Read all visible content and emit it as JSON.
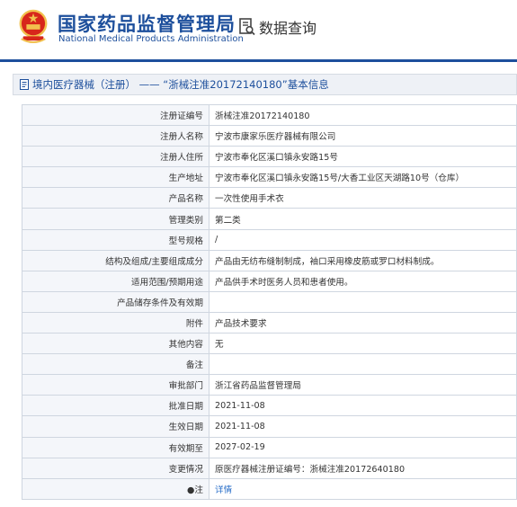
{
  "header": {
    "org_cn": "国家药品监督管理局",
    "org_en": "National Medical Products Administration",
    "query": "数据查询",
    "brand_color": "#1d4f9c",
    "emblem_icon": "national-emblem-icon",
    "query_icon": "document-search-icon"
  },
  "titlebar": {
    "text": "境内医疗器械（注册） —— “浙械注准20172140180”基本信息",
    "icon": "document-icon"
  },
  "rows": [
    {
      "label": "注册证编号",
      "value": "浙械注准20172140180"
    },
    {
      "label": "注册人名称",
      "value": "宁波市康家乐医疗器械有限公司"
    },
    {
      "label": "注册人住所",
      "value": "宁波市奉化区溪口镇永安路15号"
    },
    {
      "label": "生产地址",
      "value": "宁波市奉化区溪口镇永安路15号/大香工业区天湖路10号（仓库）"
    },
    {
      "label": "产品名称",
      "value": "一次性使用手术衣"
    },
    {
      "label": "管理类别",
      "value": "第二类"
    },
    {
      "label": "型号规格",
      "value": "/"
    },
    {
      "label": "结构及组成/主要组成成分",
      "value": "产品由无纺布缝制制成，袖口采用橡皮筋或罗口材料制成。"
    },
    {
      "label": "适用范围/预期用途",
      "value": "产品供手术时医务人员和患者使用。"
    },
    {
      "label": "产品储存条件及有效期",
      "value": ""
    },
    {
      "label": "附件",
      "value": "产品技术要求"
    },
    {
      "label": "其他内容",
      "value": "无"
    },
    {
      "label": "备注",
      "value": ""
    },
    {
      "label": "审批部门",
      "value": "浙江省药品监督管理局"
    },
    {
      "label": "批准日期",
      "value": "2021-11-08"
    },
    {
      "label": "生效日期",
      "value": "2021-11-08"
    },
    {
      "label": "有效期至",
      "value": "2027-02-19"
    },
    {
      "label": "变更情况",
      "value": "原医疗器械注册证编号：浙械注准20172640180"
    },
    {
      "label": "●注",
      "value": "详情",
      "is_link": true
    }
  ]
}
